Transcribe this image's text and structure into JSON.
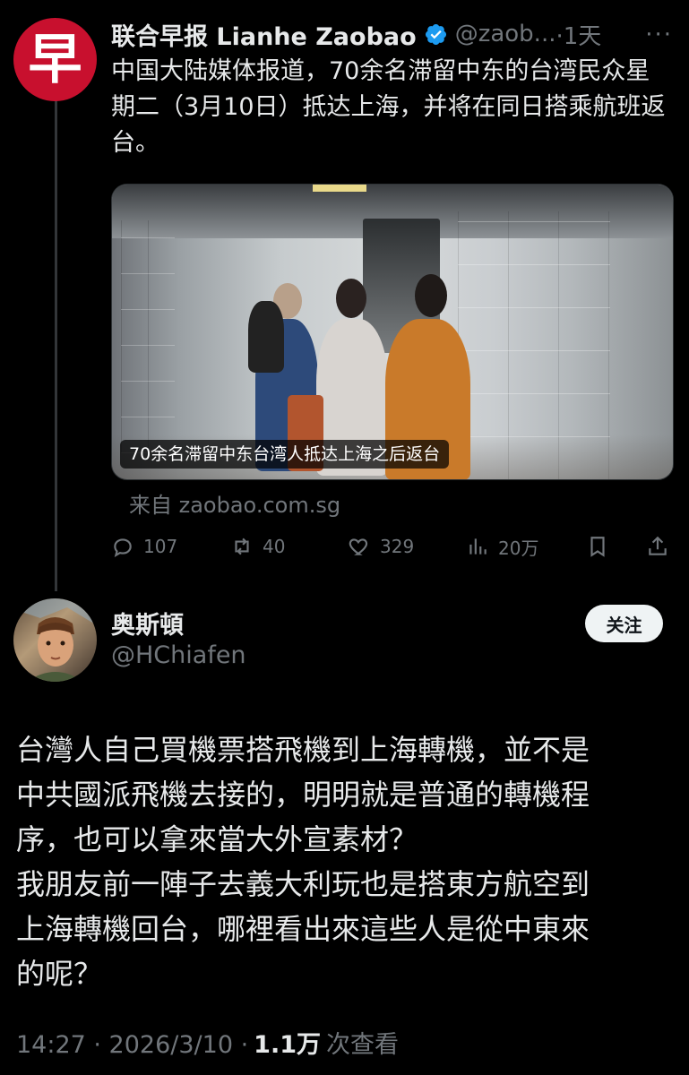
{
  "parent_tweet": {
    "avatar_char": "早",
    "display_name": "联合早报 Lianhe Zaobao",
    "handle": "@zaob...",
    "time": "·1天",
    "text": "中国大陆媒体报道，70余名滞留中东的台湾民众星期二（3月10日）抵达上海，并将在同日搭乘航班返台。",
    "media_caption": "70余名滞留中东台湾人抵达上海之后返台",
    "source": "来自 zaobao.com.sg",
    "stats": {
      "replies": "107",
      "reposts": "40",
      "likes": "329",
      "views": "20万"
    }
  },
  "main_tweet": {
    "display_name": "奥斯頓",
    "handle": "@HChiafen",
    "follow_label": "关注",
    "lines": [
      "台灣人自己買機票搭飛機到上海轉機，並不是",
      "中共國派飛機去接的，明明就是普通的轉機程",
      "序，也可以拿來當大外宣素材？",
      "我朋友前一陣子去義大利玩也是搭東方航空到",
      "上海轉機回台，哪裡看出來這些人是從中東來",
      "的呢？"
    ],
    "time": "14:27 · 2026/3/10 ·",
    "views_count": "1.1万",
    "views_label": "次查看"
  },
  "colors": {
    "background": "#000000",
    "text": "#e7e9ea",
    "muted": "#71767b",
    "verified": "#1d9bf0",
    "zaobao_red": "#c8102e"
  }
}
